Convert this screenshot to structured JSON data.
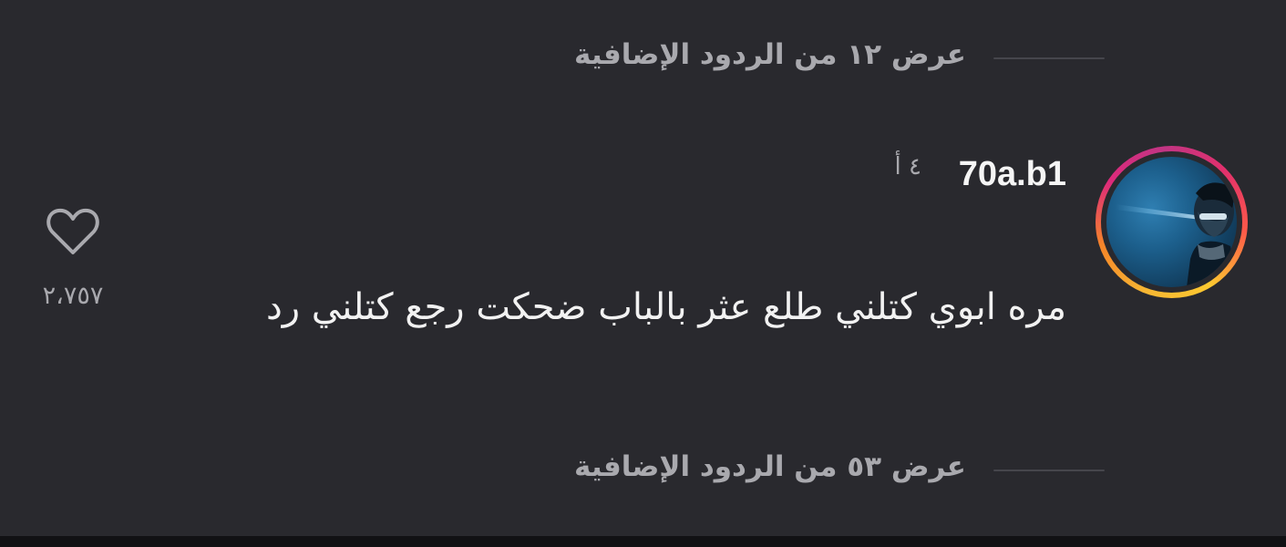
{
  "replies_top": {
    "label": "عرض ١٢ من الردود الإضافية"
  },
  "comment": {
    "username": "70a.b1",
    "time": "٤ أ",
    "text": "مره ابوي كتلني طلع عثر بالباب ضحكت رجع كتلني رد",
    "likes": "٢،٧٥٧"
  },
  "replies_bottom": {
    "label": "عرض ٥٣ من الردود الإضافية"
  },
  "icons": {
    "like": "heart-outline-icon",
    "story_ring": "instagram-gradient-ring"
  },
  "colors": {
    "background": "#29292e",
    "muted_text": "#a9a9ae",
    "primary_text": "#f2f2f2"
  }
}
